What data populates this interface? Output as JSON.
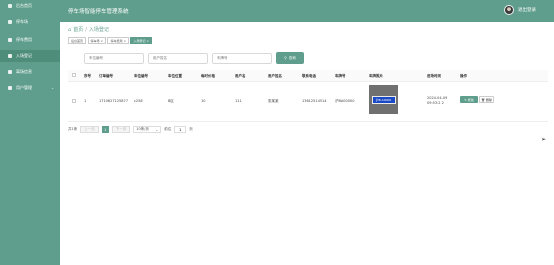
{
  "header": {
    "app_title": "停车场智能停车管理系统",
    "user": "退出登录"
  },
  "sidebar": {
    "items": [
      {
        "label": "后台首页",
        "icon": "home-icon"
      },
      {
        "label": "停车场",
        "icon": "parking-icon"
      },
      {
        "label": "停车费用",
        "icon": "fee-icon"
      },
      {
        "label": "入场登记",
        "icon": "entry-icon"
      },
      {
        "label": "离场信息",
        "icon": "exit-icon"
      },
      {
        "label": "用户管理",
        "icon": "users-icon"
      }
    ]
  },
  "breadcrumb": {
    "home": "首页",
    "separator": "/",
    "current": "入场登记"
  },
  "tabs": [
    {
      "label": "后台首页"
    },
    {
      "label": "停车场 ×"
    },
    {
      "label": "停车费用 ×"
    },
    {
      "label": "入场登记 ×"
    }
  ],
  "filters": {
    "placeholders": [
      "车位编号",
      "用户姓名",
      "车牌号"
    ],
    "search_label": "查询"
  },
  "table": {
    "columns": [
      "序号",
      "订单编号",
      "车位编号",
      "车位位置",
      "每时价格",
      "用户名",
      "用户姓名",
      "联系电话",
      "车牌号",
      "车牌照片",
      "进场时间",
      "操作"
    ],
    "rows": [
      {
        "index": "1",
        "order_no": "1710627125877",
        "spot_no": "c258",
        "location": "B区",
        "price": "10",
        "username": "111",
        "name": "张某某",
        "phone": "13612514514",
        "plate": "沪BA00000",
        "plate_text": "沪B·A0000",
        "time": "2024-04-09 09:53:2 2"
      }
    ]
  },
  "actions": {
    "edit": "修改",
    "delete": "删除"
  },
  "pagination": {
    "total_label": "共1条",
    "prev": "上一页",
    "page": "1",
    "next": "下一页",
    "page_size": "10条/页",
    "goto_label": "前往",
    "goto_value": "1",
    "page_unit": "页"
  },
  "colors": {
    "primary": "#5f9e8c"
  }
}
